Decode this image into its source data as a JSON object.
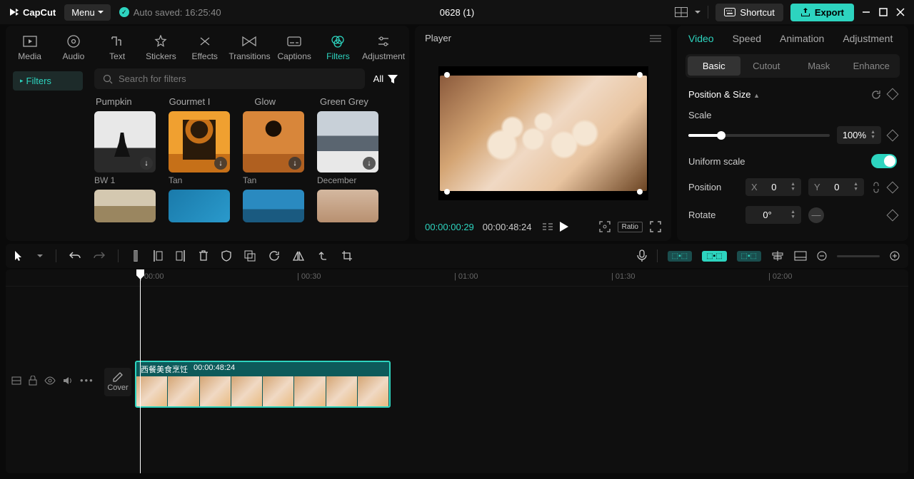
{
  "app": {
    "name": "CapCut",
    "menu": "Menu",
    "autosave": "Auto saved: 16:25:40",
    "title": "0628 (1)",
    "shortcut": "Shortcut",
    "export": "Export"
  },
  "tabs": {
    "media": "Media",
    "audio": "Audio",
    "text": "Text",
    "stickers": "Stickers",
    "effects": "Effects",
    "transitions": "Transitions",
    "captions": "Captions",
    "filters": "Filters",
    "adjustment": "Adjustment"
  },
  "filters": {
    "side_cat": "Filters",
    "search_placeholder": "Search for filters",
    "all": "All",
    "cats": [
      "Pumpkin",
      "Gourmet I",
      "Glow",
      "Green Grey"
    ],
    "row1": [
      "BW 1",
      "Tan",
      "Tan",
      "December"
    ]
  },
  "player": {
    "label": "Player",
    "t1": "00:00:00:29",
    "t2": "00:00:48:24",
    "ratio": "Ratio"
  },
  "props": {
    "tabs": {
      "video": "Video",
      "speed": "Speed",
      "animation": "Animation",
      "adjustment": "Adjustment"
    },
    "subtabs": {
      "basic": "Basic",
      "cutout": "Cutout",
      "mask": "Mask",
      "enhance": "Enhance"
    },
    "section": "Position & Size",
    "scale_label": "Scale",
    "scale_value": "100%",
    "uniform": "Uniform scale",
    "position_label": "Position",
    "x": "X",
    "y": "Y",
    "xv": "0",
    "yv": "0",
    "rotate_label": "Rotate",
    "rotate_value": "0°"
  },
  "timeline": {
    "marks": [
      "00:00",
      "00:30",
      "01:00",
      "01:30",
      "02:00"
    ],
    "cover": "Cover",
    "clip_name": "西餐美食烹饪",
    "clip_dur": "00:00:48:24"
  }
}
